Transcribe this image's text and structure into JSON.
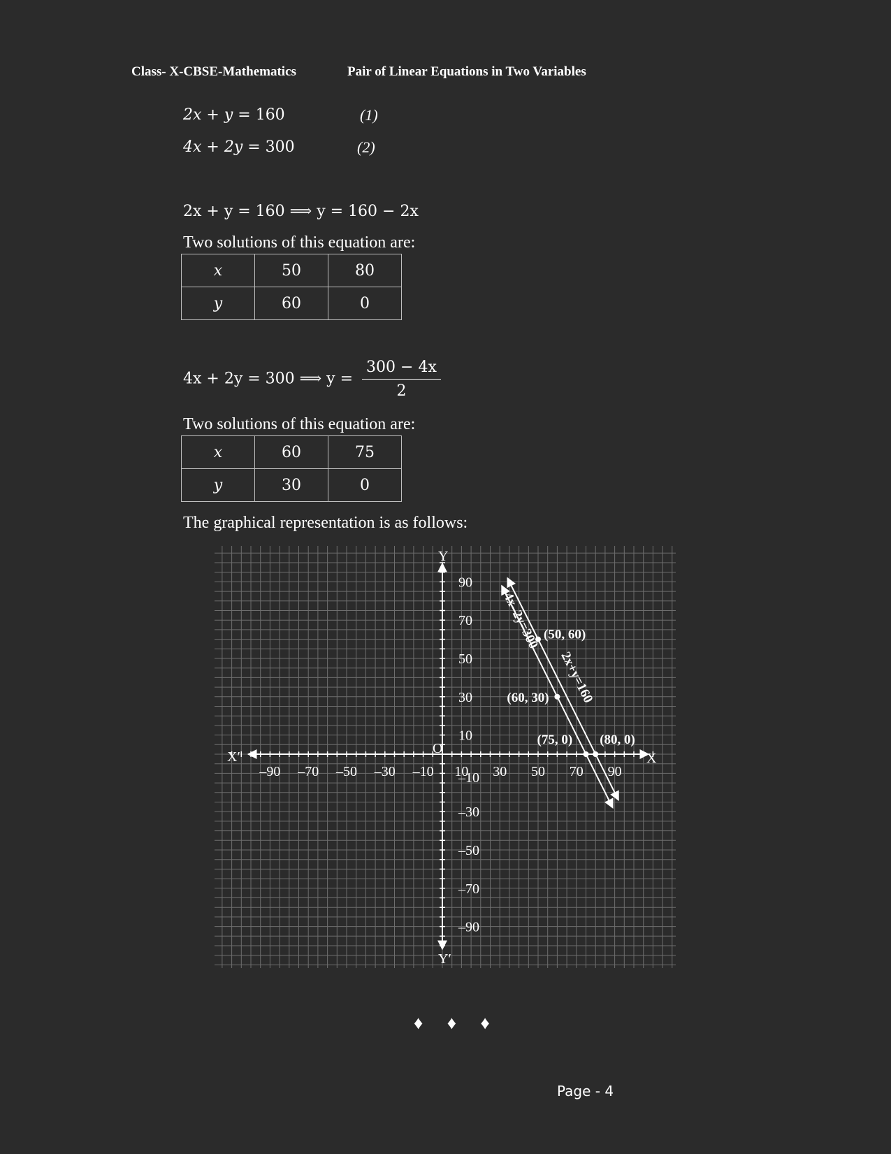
{
  "header": {
    "left": "Class- X-CBSE-Mathematics",
    "right": "Pair of Linear Equations in Two Variables"
  },
  "equations": [
    {
      "lhs": "2x + y",
      "rhs": "= 160",
      "number": "(1)"
    },
    {
      "lhs": "4x + 2y",
      "rhs": "= 300",
      "number": "(2)"
    }
  ],
  "step1": {
    "expr": "2x + y = 160 ⟹ y = 160 − 2x",
    "caption": "Two solutions of this equation are:",
    "table": [
      [
        "x",
        "50",
        "80"
      ],
      [
        "y",
        "60",
        "0"
      ]
    ]
  },
  "step2": {
    "expr_left": "4x + 2y = 300 ⟹ y =",
    "frac_num": "300 − 4x",
    "frac_den": "2",
    "caption": "Two solutions of this equation are:",
    "table": [
      [
        "x",
        "60",
        "75"
      ],
      [
        "y",
        "30",
        "0"
      ]
    ]
  },
  "graph_caption": "The graphical representation is as follows:",
  "chart_data": {
    "type": "line",
    "title": "",
    "xlabel": "X",
    "xlabel_neg": "X′",
    "ylabel": "Y",
    "ylabel_neg": "Y′",
    "origin_label": "O",
    "xlim": [
      -120,
      120
    ],
    "ylim": [
      -110,
      110
    ],
    "grid": true,
    "x_ticks": [
      {
        "value": -90,
        "label": "–90"
      },
      {
        "value": -70,
        "label": "–70"
      },
      {
        "value": -50,
        "label": "–50"
      },
      {
        "value": -30,
        "label": "–30"
      },
      {
        "value": -10,
        "label": "–10"
      },
      {
        "value": 10,
        "label": "10"
      },
      {
        "value": 30,
        "label": "30"
      },
      {
        "value": 50,
        "label": "50"
      },
      {
        "value": 70,
        "label": "70"
      },
      {
        "value": 90,
        "label": "90"
      }
    ],
    "y_ticks": [
      {
        "value": 90,
        "label": "90"
      },
      {
        "value": 70,
        "label": "70"
      },
      {
        "value": 50,
        "label": "50"
      },
      {
        "value": 30,
        "label": "30"
      },
      {
        "value": 10,
        "label": "10"
      },
      {
        "value": -10,
        "label": "–10"
      },
      {
        "value": -30,
        "label": "–30"
      },
      {
        "value": -50,
        "label": "–50"
      },
      {
        "value": -70,
        "label": "–70"
      },
      {
        "value": -90,
        "label": "–90"
      }
    ],
    "series": [
      {
        "name": "2x+y=160",
        "x_range": [
          34,
          92
        ],
        "points": [
          [
            50,
            60
          ],
          [
            80,
            0
          ]
        ]
      },
      {
        "name": "4x–2y=300",
        "x_range": [
          31,
          89
        ],
        "points": [
          [
            60,
            30
          ],
          [
            75,
            0
          ]
        ]
      }
    ],
    "point_labels": [
      {
        "x": 50,
        "y": 60,
        "label": "(50, 60)"
      },
      {
        "x": 60,
        "y": 30,
        "label": "(60, 30)"
      },
      {
        "x": 75,
        "y": 0,
        "label": "(75, 0)"
      },
      {
        "x": 80,
        "y": 0,
        "label": "(80, 0)"
      }
    ]
  },
  "decoration": "♦ ♦ ♦",
  "footer": {
    "page": "Page - 4"
  }
}
